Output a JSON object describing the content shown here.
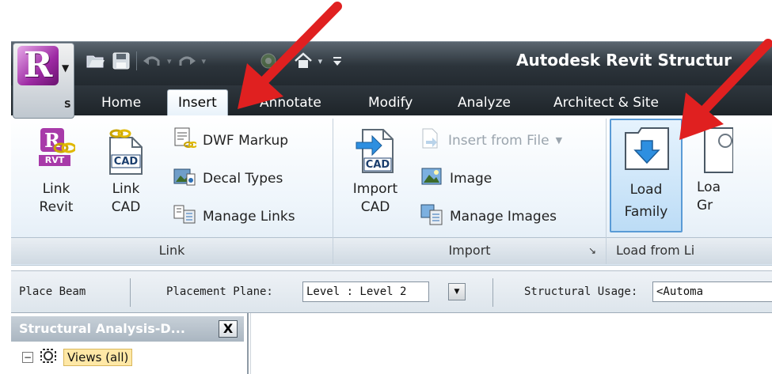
{
  "title_bar": {
    "app_title": "Autodesk Revit Structur",
    "app_button_badge": "S",
    "quick_access_icons": [
      "open-icon",
      "save-icon",
      "undo-icon",
      "redo-icon",
      "sync-icon",
      "home-icon",
      "dropdown-icon"
    ]
  },
  "tabs": [
    {
      "label": "Home",
      "active": false
    },
    {
      "label": "Insert",
      "active": true
    },
    {
      "label": "Annotate",
      "active": false
    },
    {
      "label": "Modify",
      "active": false
    },
    {
      "label": "Analyze",
      "active": false
    },
    {
      "label": "Architect & Site",
      "active": false
    }
  ],
  "ribbon": {
    "link_panel": {
      "title": "Link",
      "link_revit": {
        "line1": "Link",
        "line2": "Revit",
        "badge": "RVT"
      },
      "link_cad": {
        "line1": "Link",
        "line2": "CAD",
        "badge": "CAD"
      },
      "dwf_markup": "DWF Markup",
      "decal_types": "Decal Types",
      "manage_links": "Manage Links"
    },
    "import_panel": {
      "title": "Import",
      "import_cad": {
        "line1": "Import",
        "line2": "CAD",
        "badge": "CAD"
      },
      "insert_from_file": "Insert from File",
      "image": "Image",
      "manage_images": "Manage Images",
      "launcher": "↘"
    },
    "load_panel": {
      "title": "Load from Li",
      "load_family": {
        "line1": "Load",
        "line2": "Family"
      },
      "load_group": {
        "line1": "Loa",
        "line2": "Gr"
      }
    }
  },
  "options_bar": {
    "command": "Place Beam",
    "placement_plane_label": "Placement Plane:",
    "placement_plane_value": "Level : Level 2",
    "structural_usage_label": "Structural Usage:",
    "structural_usage_value": "<Automa"
  },
  "project_browser": {
    "title": "Structural Analysis-D...",
    "close": "X",
    "tree": [
      {
        "toggle": "−",
        "label": "Views (all)"
      }
    ]
  },
  "colors": {
    "accent_arrow": "#e02020",
    "selection_blue": "#5a9bd6",
    "ribbon_dark": "#2a3137"
  }
}
